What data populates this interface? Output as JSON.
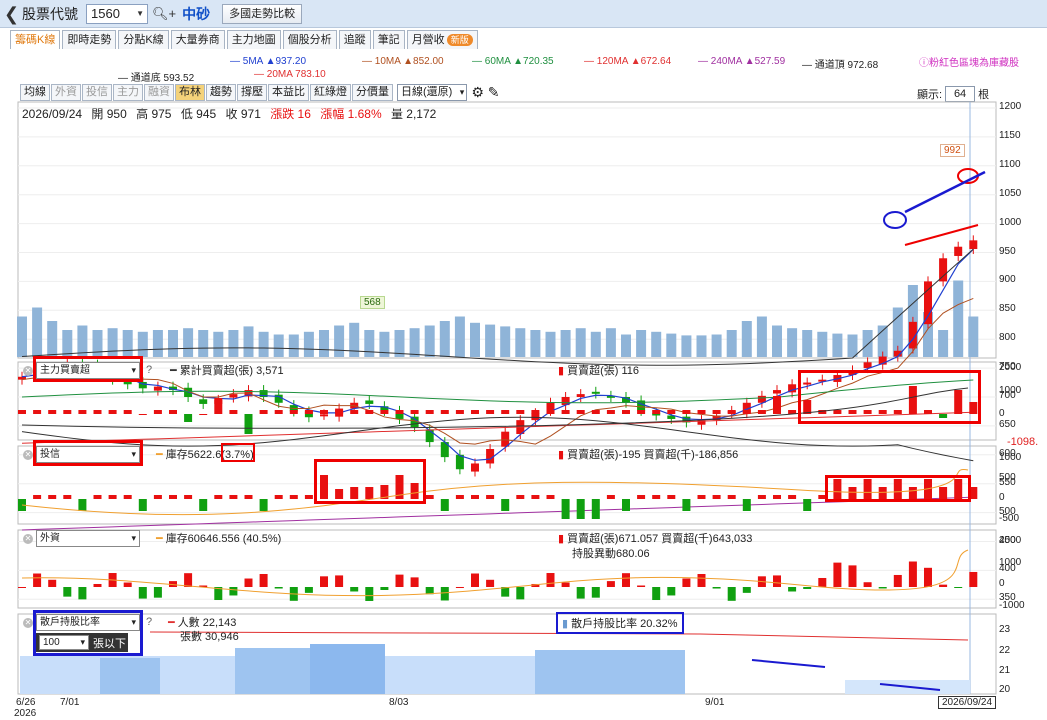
{
  "topbar": {
    "back_glyph": "❮",
    "label": "股票代號",
    "code": "1560",
    "name": "中砂",
    "compare_btn": "多國走勢比較"
  },
  "tabs": [
    {
      "label": "籌碼K線",
      "active": true
    },
    {
      "label": "即時走勢"
    },
    {
      "label": "分點K線"
    },
    {
      "label": "大量券商"
    },
    {
      "label": "主力地圖"
    },
    {
      "label": "個股分析"
    },
    {
      "label": "追蹤"
    },
    {
      "label": "筆記"
    },
    {
      "label": "月營收"
    }
  ],
  "tab_badge": "新版",
  "ma_legend": [
    {
      "label": "5MA ▲937.20",
      "color": "#2040d0"
    },
    {
      "label": "10MA ▲852.00",
      "color": "#b05020"
    },
    {
      "label": "60MA ▲720.35",
      "color": "#209040"
    },
    {
      "label": "120MA ▲672.64",
      "color": "#e03030"
    },
    {
      "label": "240MA ▲527.59",
      "color": "#a030a0"
    },
    {
      "label": "通道頂 972.68",
      "color": "#222222"
    },
    {
      "label": "通道底 593.52",
      "color": "#222222"
    },
    {
      "label": "20MA 783.10",
      "color": "#e03030"
    }
  ],
  "notice": "粉紅色區塊為庫藏股",
  "toolbar": [
    {
      "label": "均線"
    },
    {
      "label": "外資",
      "disabled": true
    },
    {
      "label": "投信",
      "disabled": true
    },
    {
      "label": "主力",
      "disabled": true
    },
    {
      "label": "融資",
      "disabled": true
    },
    {
      "label": "布林",
      "on": true
    },
    {
      "label": "趨勢"
    },
    {
      "label": "撐壓"
    },
    {
      "label": "本益比"
    },
    {
      "label": "紅綠燈"
    },
    {
      "label": "分價量"
    }
  ],
  "period": "日線(還原)",
  "display": {
    "label": "顯示:",
    "value": "64",
    "unit": "根"
  },
  "info": {
    "date": "2026/09/24",
    "open": "開 950",
    "high": "高 975",
    "low": "低 945",
    "close": "收 971",
    "chg": "漲跌 16",
    "pct": "漲幅 1.68%",
    "vol": "量 2,172"
  },
  "colors": {
    "up": "#e81010",
    "down": "#10a010"
  },
  "annotations": {
    "high_label": "992",
    "low_label": "568"
  },
  "price_axis": [
    "1200",
    "1150",
    "1100",
    "1050",
    "1000",
    "950",
    "900",
    "850",
    "800",
    "750",
    "700",
    "650",
    "600",
    "550",
    "500",
    "450",
    "400",
    "350"
  ],
  "panel1": {
    "select": "主力買賣超",
    "question": "?",
    "l1": "累計買賣超(張) 3,571",
    "l2": "買賣超(張) 116",
    "axis": [
      "2000",
      "1000",
      "0"
    ],
    "side": "-1098."
  },
  "panel2": {
    "select": "投信",
    "l1a": "庫存5622.6",
    "l1b": "(3.7%)",
    "l2": "買賣超(張)-195 買賣超(千)-186,856",
    "axis": [
      "1000",
      "500",
      "0",
      "-500"
    ]
  },
  "panel3": {
    "select": "外資",
    "l1": "庫存60646.556 (40.5%)",
    "l2": "買賣超(張)671.057 買賣超(千)643,033",
    "l3": "持股異動680.06",
    "axis": [
      "2000",
      "1000",
      "0",
      "-1000"
    ]
  },
  "panel4": {
    "select": "散戶持股比率",
    "question": "?",
    "sub_value": "100",
    "sub_unit": "張以下",
    "l1": "人數 22,143",
    "l2": "張數 30,946",
    "l3": "散戶持股比率 20.32%",
    "axis": [
      "23",
      "22",
      "21",
      "20"
    ]
  },
  "xaxis": {
    "d1": "6/26",
    "d1b": "2026",
    "d2": "7/01",
    "d3": "8/03",
    "d4": "9/01",
    "cur": "2026/09/24"
  }
}
